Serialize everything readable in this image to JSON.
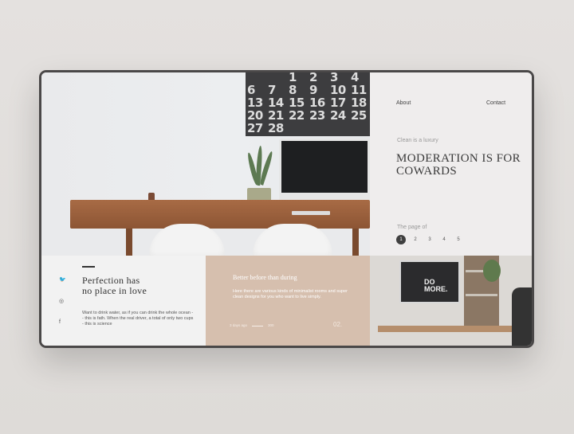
{
  "nav": {
    "about": "About",
    "contact": "Contact"
  },
  "hero": {
    "tagline": "Clean is a luxury",
    "headline": "MODERATION IS FOR COWARDS",
    "page_label": "The page of",
    "pages": [
      "1",
      "2",
      "3",
      "4",
      "5"
    ],
    "active_page": "1"
  },
  "calendar": {
    "numbers": [
      "1",
      "2",
      "3",
      "4",
      "6",
      "7",
      "8",
      "9",
      "10",
      "11",
      "13",
      "14",
      "15",
      "16",
      "17",
      "18",
      "20",
      "21",
      "22",
      "23",
      "24",
      "25",
      "27",
      "28"
    ]
  },
  "social": {
    "items": [
      {
        "icon": "twitter-icon",
        "glyph": "🐦"
      },
      {
        "icon": "instagram-icon",
        "glyph": "◎"
      },
      {
        "icon": "facebook-icon",
        "glyph": "f"
      }
    ]
  },
  "card1": {
    "title": "Perfection has\nno place in love",
    "text": "Want to drink water, as if you can drink the whole ocean -- this is fath. When the real driver, a total of only two cups - this is science"
  },
  "card2": {
    "title": "Better before than during",
    "text": "Here there are various kinds of minimalist rooms and super clean designs for you who want to live simply.",
    "meta_time": "3 days ago",
    "meta_count": "300",
    "number": "02."
  },
  "photo2": {
    "screen_text": "DO\nMORE."
  },
  "colors": {
    "accent_card": "#d6bfae",
    "frame": "#4a4848",
    "panel": "#efeded"
  }
}
